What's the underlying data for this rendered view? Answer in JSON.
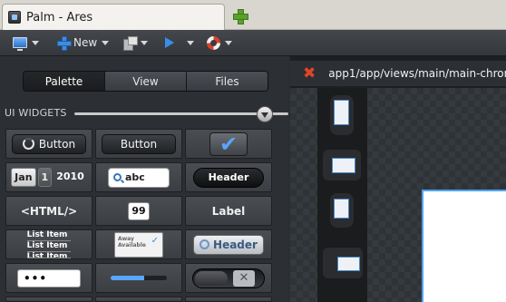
{
  "browser": {
    "tab_title": "Palm - Ares"
  },
  "toolbar": {
    "new_label": "New"
  },
  "palette": {
    "tabs": [
      "Palette",
      "View",
      "Files"
    ],
    "section_title": "UI WIDGETS",
    "widgets": {
      "activity_button": "Button",
      "button": "Button",
      "date_month": "Jan",
      "date_day": "1",
      "date_year": "2010",
      "search_text": "abc",
      "header": "Header",
      "html": "<HTML/>",
      "integer": "99",
      "label": "Label",
      "list_items": [
        "List Item",
        "List Item",
        "List Item"
      ],
      "mini_list_items": [
        "Away",
        "Available"
      ],
      "header_light": "Header",
      "password": "•••",
      "progress_value": 0.6
    }
  },
  "editor": {
    "path": "app1/app/views/main/main-chrome"
  },
  "colors": {
    "accent_blue": "#4ea1f5",
    "close_red": "#e0442a",
    "new_tab_green": "#5aa02c"
  }
}
